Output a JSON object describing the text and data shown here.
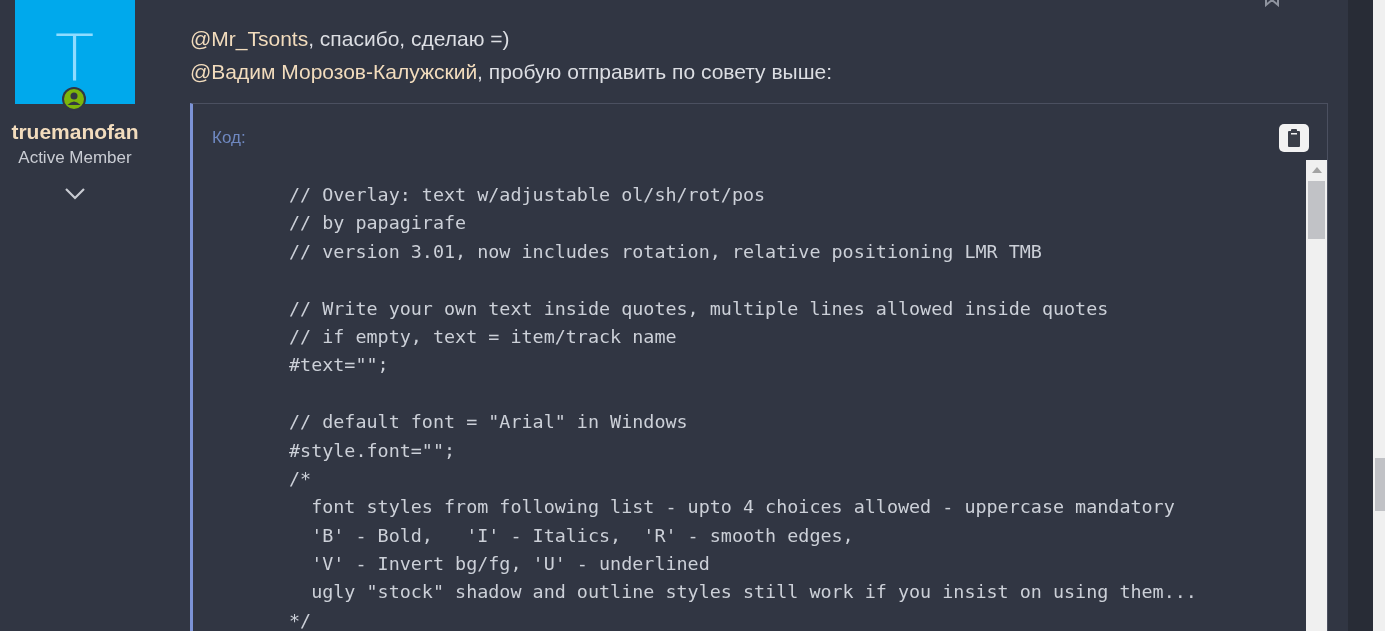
{
  "post": {
    "author": {
      "initial": "T",
      "name": "truemanofan",
      "title": "Active Member",
      "online": true
    },
    "message": [
      {
        "mention": "@Mr_Tsonts",
        "text": ", спасибо, сделаю =)"
      },
      {
        "mention": "@Вадим Морозов-Калужский",
        "text": ", пробую отправить по совету выше:"
      }
    ],
    "code": {
      "label": "Код:",
      "blocks": [
        [
          "// Overlay: text w/adjustable ol/sh/rot/pos",
          "// by papagirafe",
          "// version 3.01, now includes rotation, relative positioning LMR TMB"
        ],
        [
          "// Write your own text inside quotes, multiple lines allowed inside quotes",
          "// if empty, text = item/track name",
          "#text=\"\";"
        ],
        [
          "// default font = \"Arial\" in Windows",
          "#style.font=\"\";",
          "/*",
          "  font styles from following list - upto 4 choices allowed - uppercase mandatory",
          "  'B' - Bold,   'I' - Italics,  'R' - smooth edges,",
          "  'V' - Invert bg/fg, 'U' - underlined",
          "  ugly \"stock\" shadow and outline styles still work if you insist on using them...",
          "*/"
        ]
      ]
    }
  }
}
